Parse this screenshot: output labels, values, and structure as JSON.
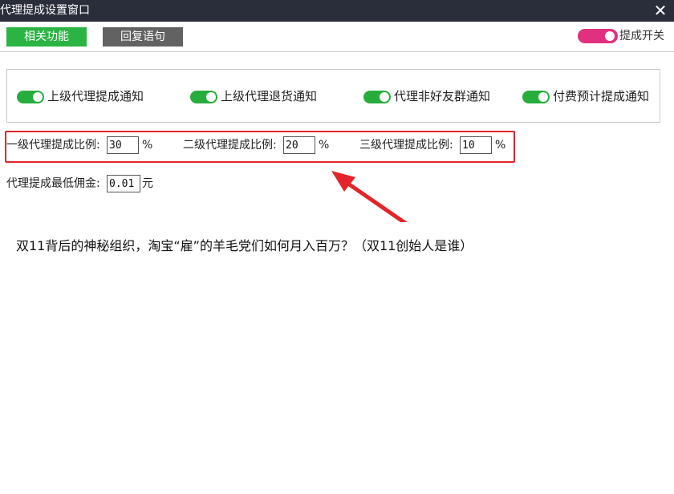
{
  "window": {
    "title": "代理提成设置窗口",
    "close_icon": "close-icon"
  },
  "toolbar": {
    "related_label": "相关功能",
    "reply_label": "回复语句",
    "master_toggle": {
      "label": "提成开关",
      "on": true,
      "color": "#e0307e"
    }
  },
  "notifications": {
    "items": [
      {
        "label": "上级代理提成通知",
        "on": true
      },
      {
        "label": "上级代理退货通知",
        "on": true
      },
      {
        "label": "代理非好友群通知",
        "on": true
      },
      {
        "label": "付费预计提成通知",
        "on": true
      }
    ],
    "toggle_color": "#27ad3c"
  },
  "ratios": {
    "level1": {
      "label": "一级代理提成比例:",
      "value": "30",
      "unit": "%"
    },
    "level2": {
      "label": "二级代理提成比例:",
      "value": "20",
      "unit": "%"
    },
    "level3": {
      "label": "三级代理提成比例:",
      "value": "10",
      "unit": "%"
    },
    "highlight_color": "#e3242b"
  },
  "min_commission": {
    "label": "代理提成最低佣金:",
    "value": "0.01",
    "unit": "元"
  },
  "caption": {
    "text": "双11背后的神秘组织，淘宝“雇”的羊毛党们如何月入百万？（双11创始人是谁）"
  },
  "colors": {
    "titlebar": "#2a2e3b",
    "primary_button": "#2bb443",
    "secondary_button": "#626262",
    "annotation_arrow": "#e3242b"
  }
}
